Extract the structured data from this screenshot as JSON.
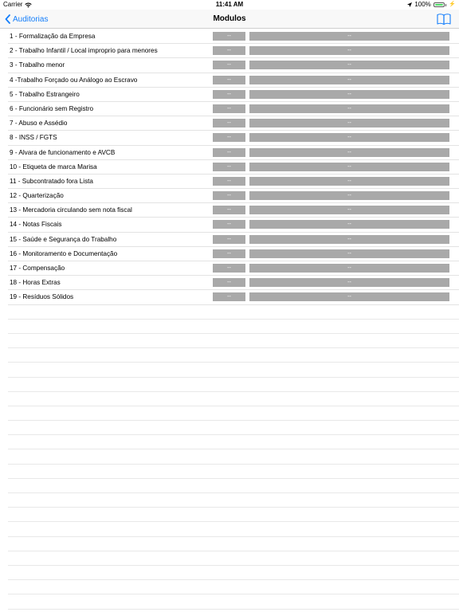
{
  "status_bar": {
    "carrier": "Carrier",
    "time": "11:41 AM",
    "battery": "100%"
  },
  "nav": {
    "back_label": "Auditorias",
    "title": "Modulos",
    "book_icon": "book-icon"
  },
  "modules": [
    {
      "label": "1 - Formalização da Empresa",
      "value1": "--",
      "value2": "--"
    },
    {
      "label": "2 - Trabalho Infantil / Local improprio para menores",
      "value1": "--",
      "value2": "--"
    },
    {
      "label": "3 - Trabalho menor",
      "value1": "--",
      "value2": "--"
    },
    {
      "label": "4 -Trabalho Forçado ou Análogo ao Escravo",
      "value1": "--",
      "value2": "--"
    },
    {
      "label": "5 - Trabalho Estrangeiro",
      "value1": "--",
      "value2": "--"
    },
    {
      "label": "6 - Funcionário sem Registro",
      "value1": "--",
      "value2": "--"
    },
    {
      "label": "7 - Abuso e Assédio",
      "value1": "--",
      "value2": "--"
    },
    {
      "label": "8 - INSS / FGTS",
      "value1": "--",
      "value2": "--"
    },
    {
      "label": "9 - Alvara de funcionamento e AVCB",
      "value1": "--",
      "value2": "--"
    },
    {
      "label": "10 - Etiqueta de marca Marisa",
      "value1": "--",
      "value2": "--"
    },
    {
      "label": "11 - Subcontratado fora Lista",
      "value1": "--",
      "value2": "--"
    },
    {
      "label": "12 - Quarterização",
      "value1": "--",
      "value2": "--"
    },
    {
      "label": "13 - Mercadoria circulando sem nota fiscal",
      "value1": "--",
      "value2": "--"
    },
    {
      "label": "14 - Notas Fiscais",
      "value1": "--",
      "value2": "--"
    },
    {
      "label": "15 - Saúde e Segurança do Trabalho",
      "value1": "--",
      "value2": "--"
    },
    {
      "label": "16 - Monitoramento e Documentação",
      "value1": "--",
      "value2": "--"
    },
    {
      "label": "17 - Compensação",
      "value1": "--",
      "value2": "--"
    },
    {
      "label": "18 - Horas Extras",
      "value1": "--",
      "value2": "--"
    },
    {
      "label": "19 - Resíduos Sólidos",
      "value1": "--",
      "value2": "--"
    }
  ],
  "colors": {
    "accent": "#147efb",
    "value_box": "#a9a9a9"
  }
}
